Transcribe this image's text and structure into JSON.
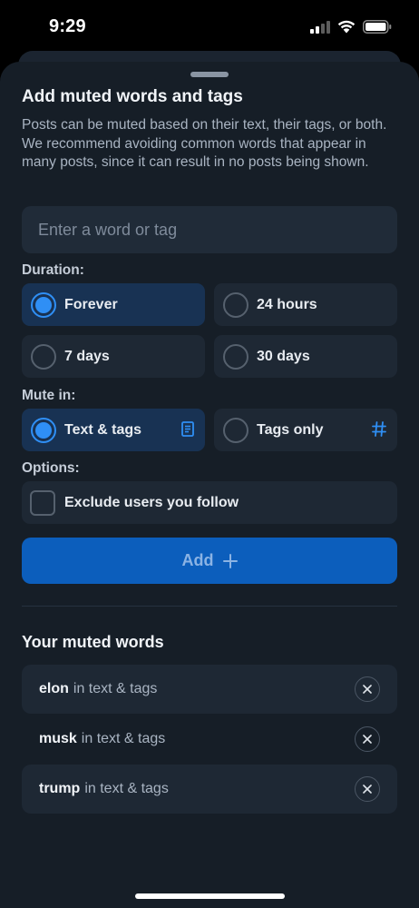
{
  "status_bar": {
    "time": "9:29"
  },
  "sheet": {
    "title": "Add muted words and tags",
    "description": "Posts can be muted based on their text, their tags, or both. We recommend avoiding common words that appear in many posts, since it can result in no posts being shown."
  },
  "input": {
    "placeholder": "Enter a word or tag"
  },
  "duration": {
    "label": "Duration:",
    "options": [
      {
        "label": "Forever",
        "selected": true
      },
      {
        "label": "24 hours",
        "selected": false
      },
      {
        "label": "7 days",
        "selected": false
      },
      {
        "label": "30 days",
        "selected": false
      }
    ]
  },
  "mute_in": {
    "label": "Mute in:",
    "options": [
      {
        "label": "Text & tags",
        "selected": true,
        "icon": "document-icon"
      },
      {
        "label": "Tags only",
        "selected": false,
        "icon": "hashtag-icon"
      }
    ]
  },
  "options": {
    "label": "Options:",
    "exclude_following": {
      "label": "Exclude users you follow",
      "checked": false
    }
  },
  "add_button": {
    "label": "Add"
  },
  "muted_words": {
    "title": "Your muted words",
    "items": [
      {
        "word": "elon",
        "scope": "in text & tags"
      },
      {
        "word": "musk",
        "scope": "in text & tags"
      },
      {
        "word": "trump",
        "scope": "in text & tags"
      }
    ]
  },
  "colors": {
    "accent": "#2f8ff5",
    "button": "#0c5ebc",
    "selected_bg": "#183253",
    "sheet_bg": "#161e27",
    "row_bg": "#1e2834"
  }
}
